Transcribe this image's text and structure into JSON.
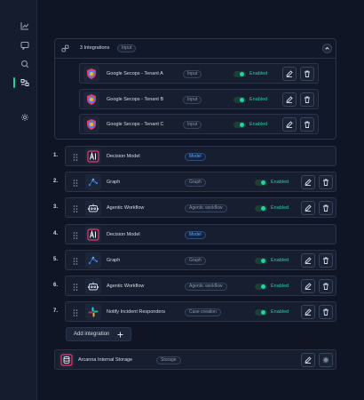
{
  "sidebar": {
    "items": [
      {
        "icon": "chart-line-icon"
      },
      {
        "icon": "chat-icon"
      },
      {
        "icon": "search-icon"
      },
      {
        "icon": "workflow-icon",
        "active": true
      },
      {
        "icon": "gear-icon"
      }
    ]
  },
  "group": {
    "title": "3 Integrations",
    "badge": "Input",
    "items": [
      {
        "name": "Google Secops - Tenant A",
        "badge": "Input",
        "status": "Enabled"
      },
      {
        "name": "Google Secops - Tenant B",
        "badge": "Input",
        "status": "Enabled"
      },
      {
        "name": "Google Secops - Tenant C",
        "badge": "Input",
        "status": "Enabled"
      }
    ]
  },
  "steps": [
    {
      "num": "1.",
      "name": "Decision Model",
      "badge": "Model",
      "logo": "ai-logo",
      "status": ""
    },
    {
      "num": "2.",
      "name": "Graph",
      "badge": "Graph",
      "logo": "graph-logo",
      "status": "Enabled"
    },
    {
      "num": "3.",
      "name": "Agentic Workflow",
      "badge": "Agentic workflow",
      "logo": "robot-logo",
      "status": "Enabled"
    },
    {
      "num": "4.",
      "name": "Decision Model",
      "badge": "Model",
      "logo": "ai-logo",
      "status": ""
    },
    {
      "num": "5.",
      "name": "Graph",
      "badge": "Graph",
      "logo": "graph-logo",
      "status": "Enabled"
    },
    {
      "num": "6.",
      "name": "Agentic Workflow",
      "badge": "Agentic workflow",
      "logo": "robot-logo",
      "status": "Enabled"
    },
    {
      "num": "7.",
      "name": "Notify Incident Responders",
      "badge": "Case creation",
      "logo": "slack-logo",
      "status": "Enabled"
    }
  ],
  "add_integration": "Add integration",
  "storage": {
    "name": "Arcanna Internal Storage",
    "badge": "Storage"
  },
  "colors": {
    "accent": "#25d0a6",
    "model": "#5aa6ff",
    "ai_logo": "#e8386b"
  }
}
